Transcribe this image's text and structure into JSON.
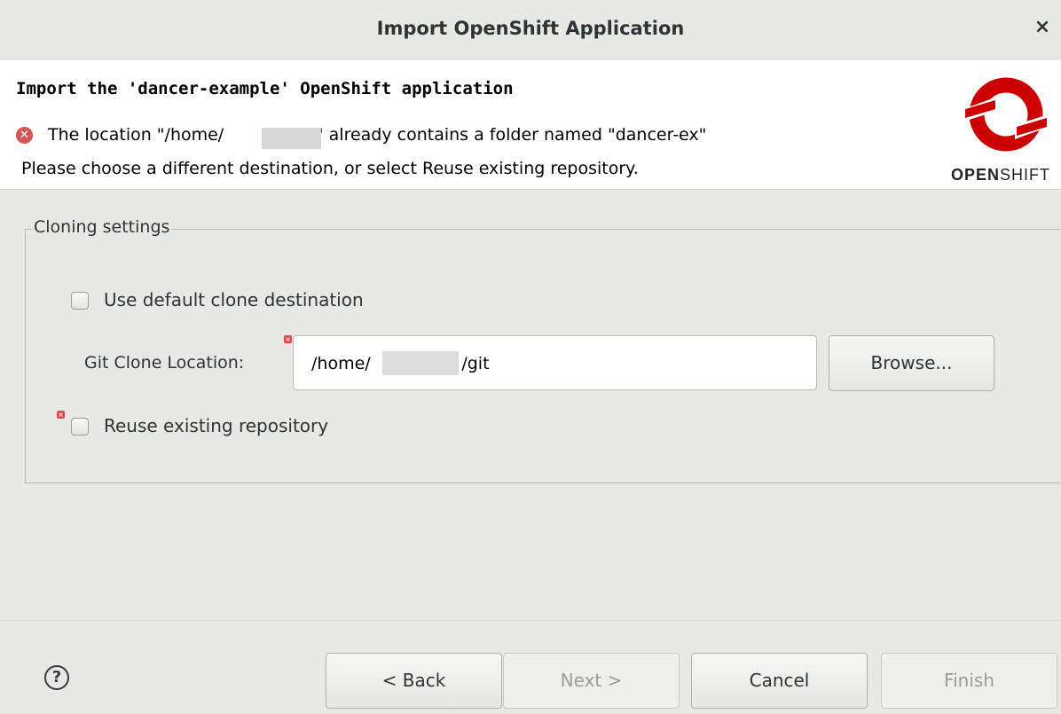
{
  "window": {
    "title": "Import OpenShift Application",
    "close_glyph": "×"
  },
  "header": {
    "title": "Import the 'dancer-example' OpenShift application",
    "error_line1": "The location \"/home/            /git\" already contains a folder named \"dancer-ex\"",
    "error_line2": "Please choose a different destination, or select Reuse existing repository.",
    "logo": {
      "bold": "OPEN",
      "light": "SHIFT",
      "color": "#cc0000"
    }
  },
  "cloning": {
    "legend": "Cloning settings",
    "use_default_label": "Use default clone destination",
    "use_default_checked": false,
    "git_clone_label": "Git Clone Location:",
    "git_clone_value": "/home/                 /git",
    "browse_label": "Browse...",
    "reuse_label": "Reuse existing repository",
    "reuse_checked": false
  },
  "footer": {
    "help_glyph": "?",
    "back_label": "< Back",
    "next_label": "Next >",
    "cancel_label": "Cancel",
    "finish_label": "Finish"
  },
  "colors": {
    "error": "#d45555",
    "disabled_text": "#9a9c98"
  }
}
